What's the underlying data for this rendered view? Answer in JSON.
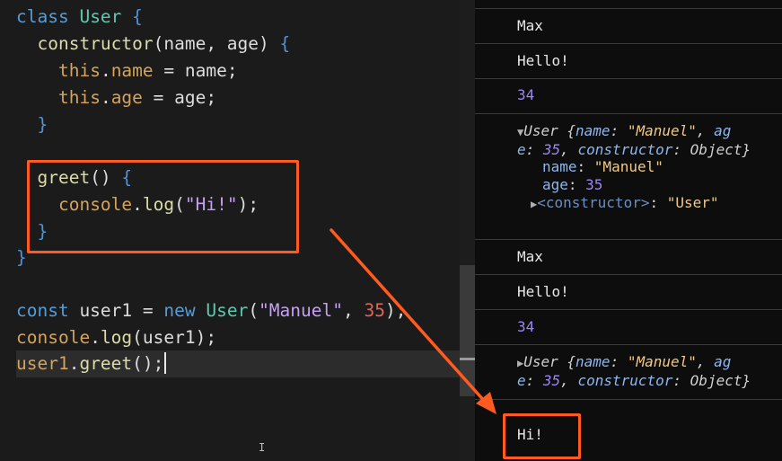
{
  "editor": {
    "lines": {
      "l1": {
        "kw": "class",
        "name": "User",
        "brace": "{"
      },
      "l2": {
        "name": "constructor",
        "params": "(name, age) ",
        "brace": "{"
      },
      "l3": {
        "this": "this",
        "dot": ".",
        "prop": "name",
        "rest": " = name;"
      },
      "l4": {
        "this": "this",
        "dot": ".",
        "prop": "age",
        "rest": " = age;"
      },
      "l5": {
        "brace": "}"
      },
      "l6": {
        "name": "greet",
        "parens": "() ",
        "brace": "{"
      },
      "l7": {
        "obj": "console",
        "dot": ".",
        "method": "log",
        "open": "(",
        "str": "\"Hi!\"",
        "close": ");"
      },
      "l8": {
        "brace": "}"
      },
      "l9": {
        "brace": "}"
      },
      "l10": {
        "kw": "const",
        "var": " user1 = ",
        "new": "new",
        "cls": " User",
        "open": "(",
        "str": "\"Manuel\"",
        "comma": ", ",
        "num": "35",
        "close": ");"
      },
      "l11": {
        "obj": "console",
        "dot": ".",
        "method": "log",
        "rest": "(user1);"
      },
      "l12": {
        "obj": "user1",
        "dot": ".",
        "method": "greet",
        "rest": "();"
      }
    }
  },
  "console": {
    "entries": {
      "max1": "Max",
      "hello1": "Hello!",
      "num1": "34",
      "obj1": {
        "label": "User {",
        "k1": "name",
        "v1": "\"Manuel\"",
        "sep1": ", ",
        "k2a": "ag",
        "k2b": "e",
        "v2": "35",
        "sep2": ", ",
        "k3": "constructor",
        "v3": "Object",
        "end": "}",
        "prop_name_key": "name",
        "prop_name_val": "\"Manuel\"",
        "prop_age_key": "age",
        "prop_age_val": "35",
        "prop_ctor_key": "<constructor>",
        "prop_ctor_val": "\"User\""
      },
      "max2": "Max",
      "hello2": "Hello!",
      "num2": "34",
      "obj2": {
        "label": "User {",
        "k1": "name",
        "v1": "\"Manuel\"",
        "sep1": ", ",
        "k2a": "ag",
        "k2b": "e",
        "v2": "35",
        "sep2": ", ",
        "k3": "constructor",
        "v3": "Object",
        "end": "}"
      },
      "hi": "Hi!"
    }
  },
  "colors": {
    "annotation": "#ff5a1f",
    "keyword": "#569cd6",
    "class_name": "#5fc9b0",
    "function": "#dcdcaa",
    "string": "#c49ff3",
    "number": "#e0655a"
  },
  "icons": {
    "expanded": "triangle-down-icon",
    "collapsed": "triangle-right-icon",
    "cursor": "ibeam-cursor-icon"
  }
}
